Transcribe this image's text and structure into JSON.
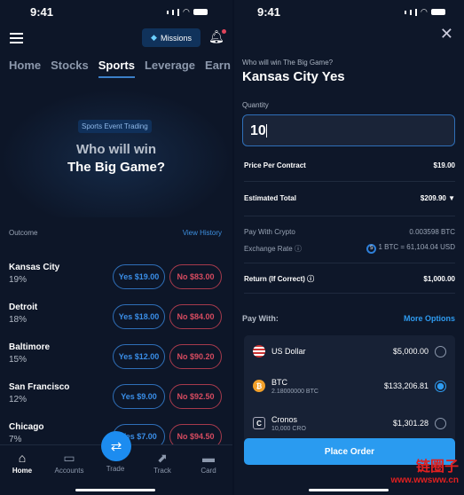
{
  "status": {
    "time": "9:41"
  },
  "left": {
    "missions_label": "Missions",
    "tabs": [
      "Home",
      "Stocks",
      "Sports",
      "Leverage",
      "Earn"
    ],
    "active_tab": "Sports",
    "hero": {
      "badge": "Sports Event Trading",
      "line1": "Who will win",
      "line2": "The Big Game?"
    },
    "outcome_label": "Outcome",
    "view_history": "View History",
    "outcomes": [
      {
        "team": "Kansas City",
        "pct": "19%",
        "yes": "Yes $19.00",
        "no": "No $83.00"
      },
      {
        "team": "Detroit",
        "pct": "18%",
        "yes": "Yes $18.00",
        "no": "No $84.00"
      },
      {
        "team": "Baltimore",
        "pct": "15%",
        "yes": "Yes $12.00",
        "no": "No $90.20"
      },
      {
        "team": "San Francisco",
        "pct": "12%",
        "yes": "Yes $9.00",
        "no": "No $92.50"
      },
      {
        "team": "Chicago",
        "pct": "7%",
        "yes": "Yes $7.00",
        "no": "No $94.50"
      }
    ],
    "nav": [
      "Home",
      "Accounts",
      "Trade",
      "Track",
      "Card"
    ]
  },
  "right": {
    "question": "Who will win The Big Game?",
    "title": "Kansas City Yes",
    "quantity_label": "Quantity",
    "quantity": "10",
    "price_label": "Price Per Contract",
    "price": "$19.00",
    "total_label": "Estimated Total",
    "total": "$209.90",
    "crypto_label": "Pay With Crypto",
    "crypto": "0.003598 BTC",
    "rate_label": "Exchange Rate",
    "rate_timer": "5",
    "rate": "1 BTC = 61,104.04 USD",
    "return_label": "Return (If Correct)",
    "return": "$1,000.00",
    "pay_with": "Pay With:",
    "more_options": "More Options",
    "methods": [
      {
        "name": "US Dollar",
        "sub": "",
        "amount": "$5,000.00",
        "selected": false
      },
      {
        "name": "BTC",
        "sub": "2.18000000 BTC",
        "amount": "$133,206.81",
        "selected": true
      },
      {
        "name": "Cronos",
        "sub": "10,000 CRO",
        "amount": "$1,301.28",
        "selected": false
      }
    ],
    "place_order": "Place Order"
  },
  "watermark": {
    "cn": "链圈子",
    "url": "www.wwsww.cn"
  },
  "colors": {
    "accent": "#2a9bf0",
    "yes": "#3a8ee8",
    "no": "#d64b60",
    "bg": "#0d1628"
  }
}
